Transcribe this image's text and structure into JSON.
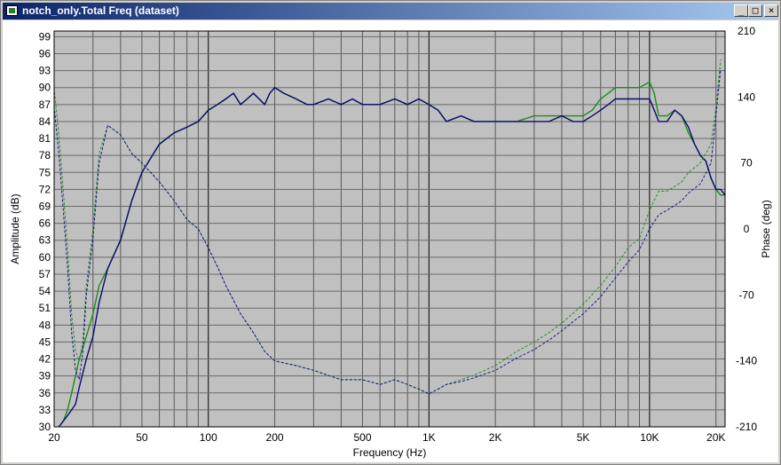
{
  "window": {
    "title": "notch_only.Total Freq (dataset)",
    "controls": {
      "minimize": "_",
      "maximize": "□",
      "close": "×"
    }
  },
  "chart_data": {
    "type": "line",
    "xlabel": "Frequency (Hz)",
    "ylabel": "Amplitude (dB)",
    "y2label": "Phase (deg)",
    "xscale": "log",
    "xlim": [
      20,
      22000
    ],
    "ylim": [
      30,
      100
    ],
    "y2lim": [
      -210,
      210
    ],
    "grid": true,
    "plot_background": "#c0c0c0",
    "x_ticks": [
      {
        "value": 20,
        "label": "20"
      },
      {
        "value": 50,
        "label": "50"
      },
      {
        "value": 100,
        "label": "100"
      },
      {
        "value": 200,
        "label": "200"
      },
      {
        "value": 500,
        "label": "500"
      },
      {
        "value": 1000,
        "label": "1K"
      },
      {
        "value": 2000,
        "label": "2K"
      },
      {
        "value": 5000,
        "label": "5K"
      },
      {
        "value": 10000,
        "label": "10K"
      },
      {
        "value": 20000,
        "label": "20K"
      }
    ],
    "y_ticks": [
      30,
      33,
      36,
      39,
      42,
      45,
      48,
      51,
      54,
      57,
      60,
      63,
      66,
      69,
      72,
      75,
      78,
      81,
      84,
      87,
      90,
      93,
      96,
      99
    ],
    "y2_ticks": [
      -210,
      -140,
      -70,
      0,
      70,
      140,
      210
    ],
    "series": [
      {
        "axis": "left",
        "style": "solid",
        "color": "#1a8c1a",
        "points": [
          [
            21,
            30
          ],
          [
            22,
            31
          ],
          [
            23,
            33
          ],
          [
            24,
            36
          ],
          [
            25,
            39
          ],
          [
            26,
            42
          ],
          [
            28,
            46
          ],
          [
            30,
            50
          ],
          [
            32,
            55
          ],
          [
            35,
            58
          ],
          [
            40,
            63
          ],
          [
            45,
            70
          ],
          [
            50,
            75
          ],
          [
            60,
            80
          ],
          [
            70,
            82
          ],
          [
            80,
            83
          ],
          [
            90,
            84
          ],
          [
            100,
            86
          ],
          [
            110,
            87
          ],
          [
            120,
            88
          ],
          [
            130,
            89
          ],
          [
            140,
            87
          ],
          [
            150,
            88
          ],
          [
            160,
            89
          ],
          [
            170,
            88
          ],
          [
            180,
            87
          ],
          [
            190,
            89
          ],
          [
            200,
            90
          ],
          [
            220,
            89
          ],
          [
            250,
            88
          ],
          [
            280,
            87
          ],
          [
            300,
            87
          ],
          [
            350,
            88
          ],
          [
            400,
            87
          ],
          [
            450,
            88
          ],
          [
            500,
            87
          ],
          [
            600,
            87
          ],
          [
            700,
            88
          ],
          [
            800,
            87
          ],
          [
            900,
            88
          ],
          [
            1000,
            87
          ],
          [
            1100,
            86
          ],
          [
            1200,
            84
          ],
          [
            1400,
            85
          ],
          [
            1600,
            84
          ],
          [
            1800,
            84
          ],
          [
            2000,
            84
          ],
          [
            2500,
            84
          ],
          [
            3000,
            85
          ],
          [
            3500,
            85
          ],
          [
            4000,
            85
          ],
          [
            4500,
            85
          ],
          [
            5000,
            85
          ],
          [
            5500,
            86
          ],
          [
            6000,
            88
          ],
          [
            6500,
            89
          ],
          [
            7000,
            90
          ],
          [
            8000,
            90
          ],
          [
            9000,
            90
          ],
          [
            10000,
            91
          ],
          [
            10500,
            89
          ],
          [
            11000,
            85
          ],
          [
            12000,
            85
          ],
          [
            13000,
            86
          ],
          [
            14000,
            85
          ],
          [
            15000,
            82
          ],
          [
            16000,
            80
          ],
          [
            17000,
            78
          ],
          [
            18000,
            77
          ],
          [
            19000,
            74
          ],
          [
            20000,
            72
          ],
          [
            21000,
            71
          ],
          [
            22000,
            71
          ]
        ]
      },
      {
        "axis": "left",
        "style": "solid",
        "color": "#0a0a70",
        "points": [
          [
            21,
            30
          ],
          [
            22,
            31
          ],
          [
            23,
            32
          ],
          [
            24,
            33
          ],
          [
            25,
            34
          ],
          [
            26,
            37
          ],
          [
            28,
            42
          ],
          [
            30,
            46
          ],
          [
            32,
            52
          ],
          [
            35,
            58
          ],
          [
            40,
            63
          ],
          [
            45,
            70
          ],
          [
            50,
            75
          ],
          [
            60,
            80
          ],
          [
            70,
            82
          ],
          [
            80,
            83
          ],
          [
            90,
            84
          ],
          [
            100,
            86
          ],
          [
            110,
            87
          ],
          [
            120,
            88
          ],
          [
            130,
            89
          ],
          [
            140,
            87
          ],
          [
            150,
            88
          ],
          [
            160,
            89
          ],
          [
            170,
            88
          ],
          [
            180,
            87
          ],
          [
            190,
            89
          ],
          [
            200,
            90
          ],
          [
            220,
            89
          ],
          [
            250,
            88
          ],
          [
            280,
            87
          ],
          [
            300,
            87
          ],
          [
            350,
            88
          ],
          [
            400,
            87
          ],
          [
            450,
            88
          ],
          [
            500,
            87
          ],
          [
            600,
            87
          ],
          [
            700,
            88
          ],
          [
            800,
            87
          ],
          [
            900,
            88
          ],
          [
            1000,
            87
          ],
          [
            1100,
            86
          ],
          [
            1200,
            84
          ],
          [
            1400,
            85
          ],
          [
            1600,
            84
          ],
          [
            1800,
            84
          ],
          [
            2000,
            84
          ],
          [
            2500,
            84
          ],
          [
            3000,
            84
          ],
          [
            3500,
            84
          ],
          [
            4000,
            85
          ],
          [
            4500,
            84
          ],
          [
            5000,
            84
          ],
          [
            5500,
            85
          ],
          [
            6000,
            86
          ],
          [
            6500,
            87
          ],
          [
            7000,
            88
          ],
          [
            8000,
            88
          ],
          [
            9000,
            88
          ],
          [
            10000,
            88
          ],
          [
            10500,
            86
          ],
          [
            11000,
            84
          ],
          [
            12000,
            84
          ],
          [
            13000,
            86
          ],
          [
            14000,
            85
          ],
          [
            15000,
            83
          ],
          [
            16000,
            80
          ],
          [
            17000,
            78
          ],
          [
            18000,
            77
          ],
          [
            19000,
            74
          ],
          [
            20000,
            72
          ],
          [
            21000,
            72
          ],
          [
            22000,
            71
          ]
        ]
      },
      {
        "axis": "right",
        "style": "dash",
        "color": "#2a8a2a",
        "points": [
          [
            20,
            150
          ],
          [
            21,
            100
          ],
          [
            22,
            40
          ],
          [
            23,
            -20
          ],
          [
            24,
            -90
          ],
          [
            25,
            -130
          ],
          [
            26,
            -140
          ],
          [
            27,
            -120
          ],
          [
            28,
            -60
          ],
          [
            30,
            0
          ],
          [
            32,
            80
          ],
          [
            35,
            110
          ],
          [
            40,
            100
          ],
          [
            45,
            80
          ],
          [
            50,
            70
          ],
          [
            60,
            50
          ],
          [
            70,
            30
          ],
          [
            80,
            10
          ],
          [
            90,
            0
          ],
          [
            100,
            -20
          ],
          [
            110,
            -40
          ],
          [
            120,
            -60
          ],
          [
            140,
            -90
          ],
          [
            160,
            -110
          ],
          [
            180,
            -130
          ],
          [
            200,
            -140
          ],
          [
            250,
            -145
          ],
          [
            300,
            -150
          ],
          [
            400,
            -160
          ],
          [
            500,
            -160
          ],
          [
            600,
            -165
          ],
          [
            700,
            -160
          ],
          [
            800,
            -165
          ],
          [
            900,
            -170
          ],
          [
            1000,
            -175
          ],
          [
            1100,
            -170
          ],
          [
            1200,
            -165
          ],
          [
            1400,
            -160
          ],
          [
            1600,
            -155
          ],
          [
            2000,
            -145
          ],
          [
            2500,
            -130
          ],
          [
            3000,
            -120
          ],
          [
            3500,
            -110
          ],
          [
            4000,
            -100
          ],
          [
            5000,
            -80
          ],
          [
            6000,
            -60
          ],
          [
            7000,
            -40
          ],
          [
            8000,
            -20
          ],
          [
            9000,
            -10
          ],
          [
            10000,
            20
          ],
          [
            11000,
            40
          ],
          [
            12000,
            40
          ],
          [
            13000,
            45
          ],
          [
            14000,
            50
          ],
          [
            15000,
            60
          ],
          [
            17000,
            70
          ],
          [
            19000,
            90
          ],
          [
            20000,
            130
          ],
          [
            21000,
            180
          ]
        ]
      },
      {
        "axis": "right",
        "style": "dash",
        "color": "#1a1a80",
        "points": [
          [
            20,
            130
          ],
          [
            21,
            80
          ],
          [
            22,
            20
          ],
          [
            23,
            -40
          ],
          [
            24,
            -110
          ],
          [
            25,
            -150
          ],
          [
            26,
            -160
          ],
          [
            27,
            -130
          ],
          [
            28,
            -70
          ],
          [
            30,
            -10
          ],
          [
            32,
            70
          ],
          [
            35,
            110
          ],
          [
            40,
            100
          ],
          [
            45,
            80
          ],
          [
            50,
            70
          ],
          [
            60,
            50
          ],
          [
            70,
            30
          ],
          [
            80,
            10
          ],
          [
            90,
            0
          ],
          [
            100,
            -20
          ],
          [
            110,
            -40
          ],
          [
            120,
            -60
          ],
          [
            140,
            -90
          ],
          [
            160,
            -110
          ],
          [
            180,
            -130
          ],
          [
            200,
            -140
          ],
          [
            250,
            -145
          ],
          [
            300,
            -150
          ],
          [
            400,
            -160
          ],
          [
            500,
            -160
          ],
          [
            600,
            -165
          ],
          [
            700,
            -160
          ],
          [
            800,
            -165
          ],
          [
            900,
            -170
          ],
          [
            1000,
            -175
          ],
          [
            1100,
            -170
          ],
          [
            1200,
            -165
          ],
          [
            1400,
            -162
          ],
          [
            1600,
            -158
          ],
          [
            2000,
            -150
          ],
          [
            2500,
            -137
          ],
          [
            3000,
            -128
          ],
          [
            3500,
            -118
          ],
          [
            4000,
            -108
          ],
          [
            5000,
            -90
          ],
          [
            6000,
            -72
          ],
          [
            7000,
            -52
          ],
          [
            8000,
            -35
          ],
          [
            9000,
            -22
          ],
          [
            10000,
            0
          ],
          [
            11000,
            15
          ],
          [
            12000,
            20
          ],
          [
            13000,
            25
          ],
          [
            14000,
            30
          ],
          [
            15000,
            38
          ],
          [
            17000,
            48
          ],
          [
            19000,
            70
          ],
          [
            20000,
            120
          ],
          [
            21000,
            170
          ]
        ]
      }
    ]
  }
}
